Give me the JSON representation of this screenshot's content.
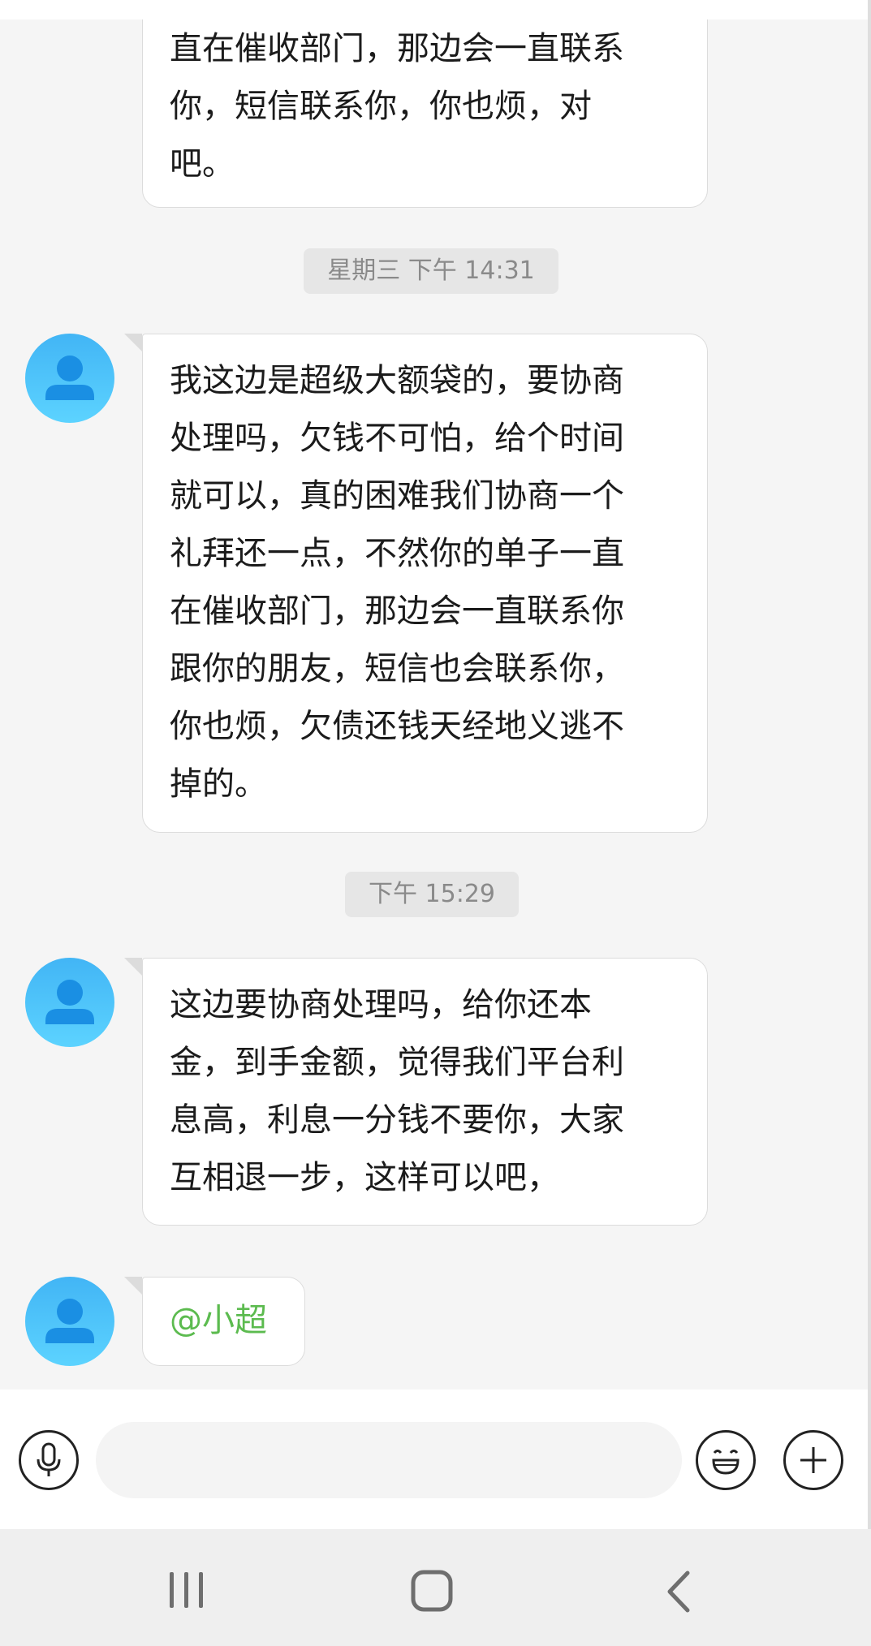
{
  "messages": [
    {
      "kind": "received",
      "lines": [
        "直在催收部门，那边会一直联系",
        "你，短信联系你，你也烦，对",
        "吧。"
      ]
    },
    {
      "kind": "timestamp",
      "text": "星期三 下午 14:31"
    },
    {
      "kind": "received",
      "lines": [
        "我这边是超级大额袋的，要协商",
        "处理吗，欠钱不可怕，给个时间",
        "就可以，真的困难我们协商一个",
        "礼拜还一点，不然你的单子一直",
        "在催收部门，那边会一直联系你",
        "跟你的朋友，短信也会联系你，",
        "你也烦，欠债还钱天经地义逃不",
        "掉的。"
      ]
    },
    {
      "kind": "timestamp",
      "text": "下午 15:29"
    },
    {
      "kind": "received",
      "lines": [
        "这边要协商处理吗，给你还本",
        "金，到手金额，觉得我们平台利",
        "息高，利息一分钱不要你，大家",
        "互相退一步，这样可以吧，"
      ]
    },
    {
      "kind": "received",
      "mention": "@小超"
    }
  ],
  "input": {
    "placeholder": "",
    "value": ""
  },
  "icons": {
    "avatar": "default-user-avatar-icon",
    "voice": "microphone-icon",
    "emoji": "smiley-icon",
    "more": "plus-icon",
    "nav_recents": "recent-apps-icon",
    "nav_home": "home-icon",
    "nav_back": "back-icon"
  },
  "colors": {
    "mention": "#5cbb4f",
    "avatar_top": "#42b5f5",
    "avatar_bottom": "#5cd3ff",
    "avatar_figure": "#1a8fe3"
  }
}
